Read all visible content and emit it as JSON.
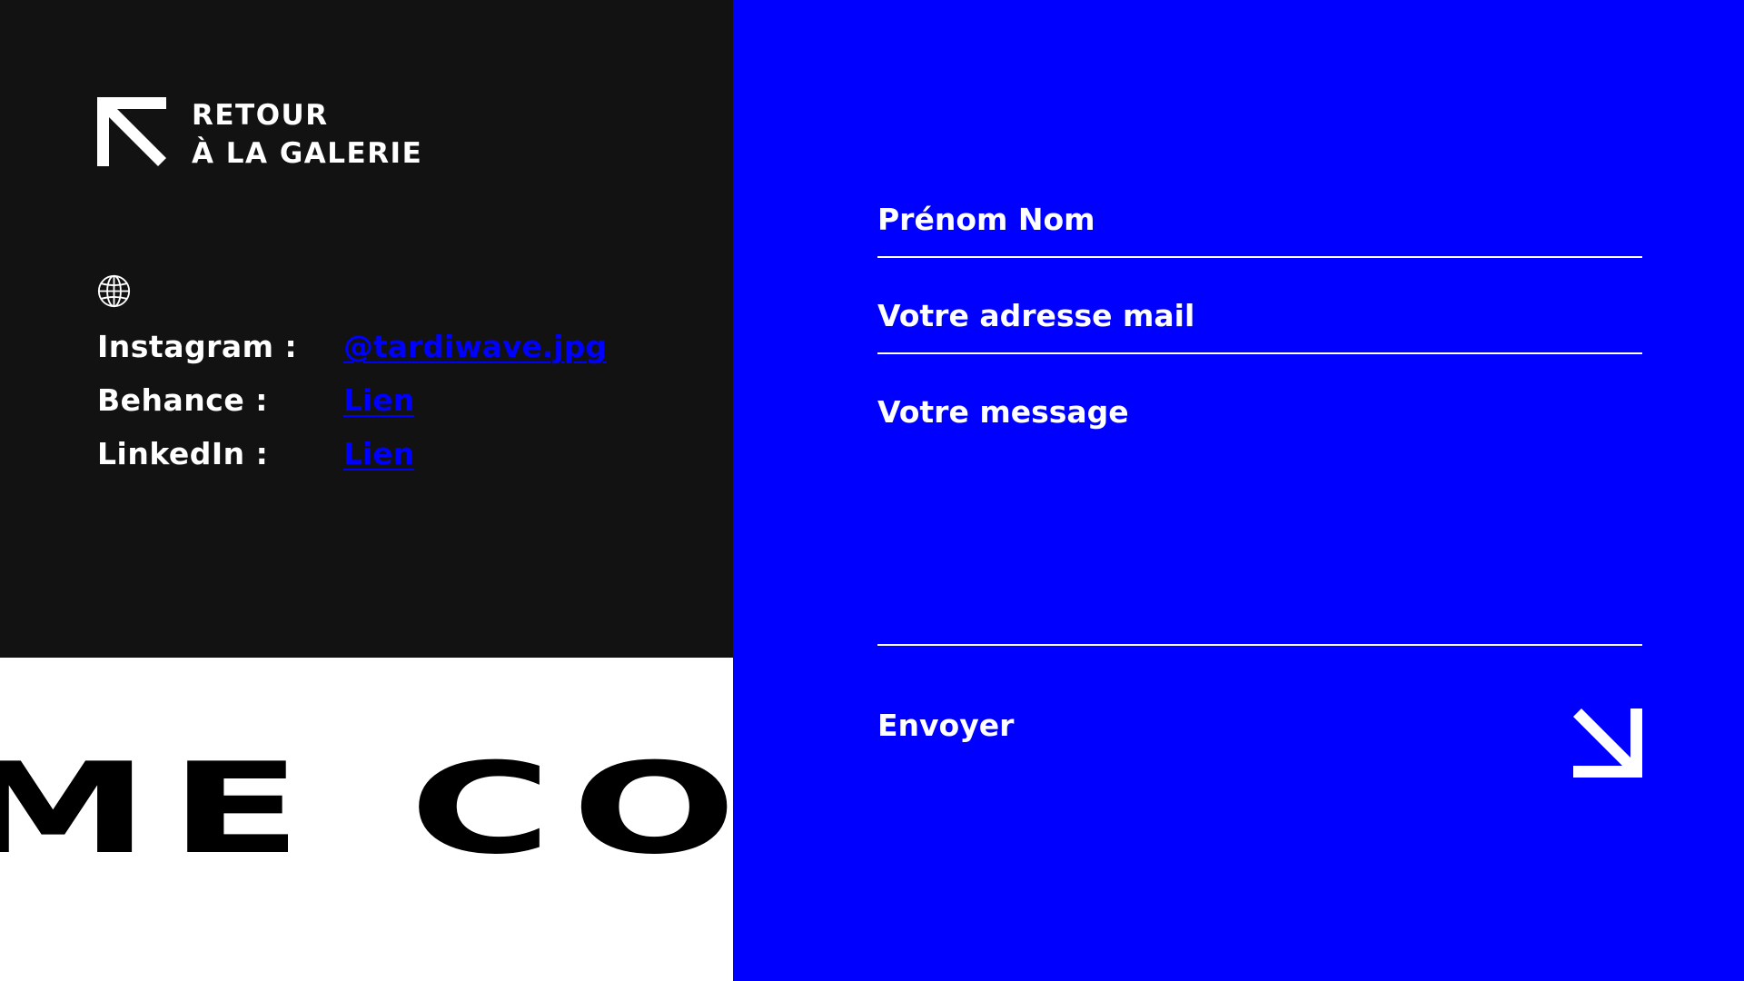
{
  "back_link": {
    "line1": "RETOUR",
    "line2": "À LA GALERIE",
    "icon": "arrow-up-left-icon"
  },
  "globe": {
    "icon": "globe-icon"
  },
  "socials": [
    {
      "label": "Instagram :",
      "link_text": "@tardiwave.jpg"
    },
    {
      "label": "Behance :",
      "link_text": "Lien"
    },
    {
      "label": "LinkedIn :",
      "link_text": "Lien"
    }
  ],
  "marquee": {
    "text": "ME CON"
  },
  "form": {
    "name_placeholder": "Prénom Nom",
    "email_placeholder": "Votre adresse mail",
    "message_placeholder": "Votre message",
    "submit_label": "Envoyer",
    "submit_icon": "arrow-down-right-icon"
  },
  "colors": {
    "dark_panel": "#121212",
    "accent_blue": "#0000fe",
    "text_white": "#ffffff",
    "marquee_bg": "#ffffff",
    "marquee_text": "#000000"
  }
}
